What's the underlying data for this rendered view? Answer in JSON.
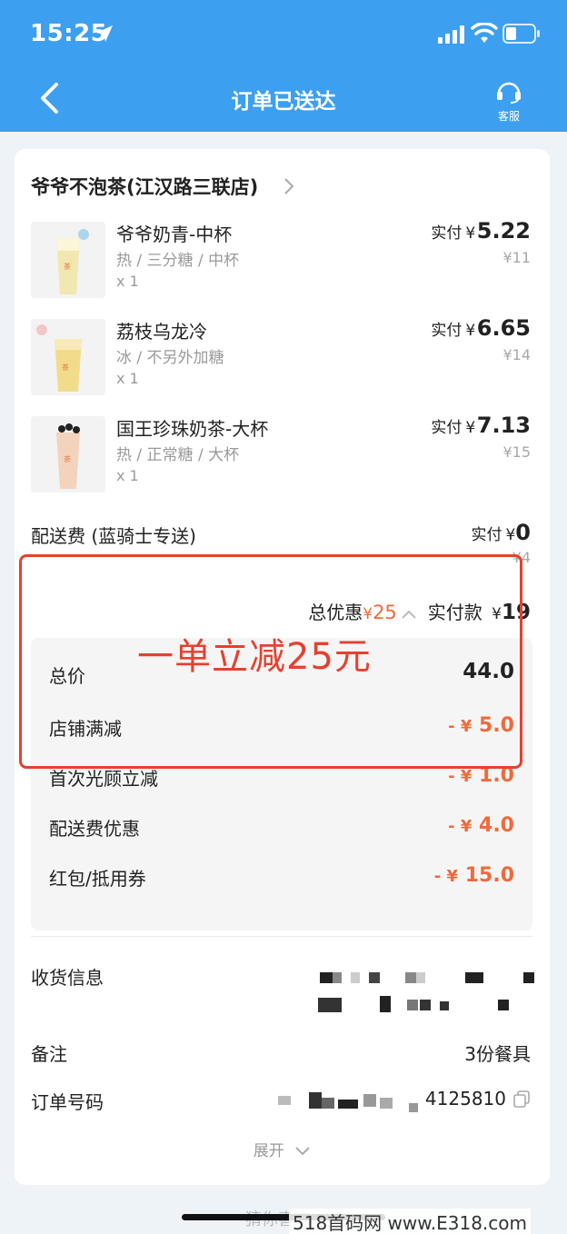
{
  "status_bar": {
    "time": "15:25"
  },
  "nav": {
    "title": "订单已送达",
    "service_label": "客服"
  },
  "shop": {
    "name": "爷爷不泡茶(江汉路三联店)"
  },
  "items": [
    {
      "name": "爷爷奶青-中杯",
      "spec": "热 / 三分糖 / 中杯",
      "qty": "x 1",
      "paid_label": "实付",
      "paid_yen": "¥",
      "paid_amount": "5.22",
      "original": "¥11"
    },
    {
      "name": "荔枝乌龙冷",
      "spec": "冰 / 不另外加糖",
      "qty": "x 1",
      "paid_label": "实付",
      "paid_yen": "¥",
      "paid_amount": "6.65",
      "original": "¥14"
    },
    {
      "name": "国王珍珠奶茶-大杯",
      "spec": "热 / 正常糖 / 大杯",
      "qty": "x 1",
      "paid_label": "实付",
      "paid_yen": "¥",
      "paid_amount": "7.13",
      "original": "¥15"
    }
  ],
  "delivery": {
    "label": "配送费 (蓝骑士专送)",
    "paid_label": "实付",
    "paid_yen": "¥",
    "paid_amount": "0",
    "original": "¥4"
  },
  "summary": {
    "discount_label": "总优惠",
    "discount_yen": "¥",
    "discount_amount": "25",
    "paid_label": "实付款",
    "paid_yen": "¥",
    "paid_amount": "19"
  },
  "breakdown": {
    "total_label": "总价",
    "total_value": "44.0",
    "rows": [
      {
        "label": "店铺满减",
        "prefix": "- ¥",
        "value": "5.0"
      },
      {
        "label": "首次光顾立减",
        "prefix": "- ¥",
        "value": "1.0"
      },
      {
        "label": "配送费优惠",
        "prefix": "- ¥",
        "value": "4.0"
      },
      {
        "label": "红包/抵用券",
        "prefix": "- ¥",
        "value": "15.0"
      }
    ]
  },
  "overlay_text": "一单立减25元",
  "info": {
    "receiver_label": "收货信息",
    "note_label": "备注",
    "note_value": "3份餐具",
    "order_label": "订单号码",
    "order_value_visible": "4125810"
  },
  "expand_label": "展开",
  "below_fold_text": "猜你喜欢",
  "watermark": "518首码网 www.E318.com",
  "colors": {
    "header": "#3d9ff0",
    "discount": "#ee6b3b",
    "highlight": "#e4412f"
  }
}
